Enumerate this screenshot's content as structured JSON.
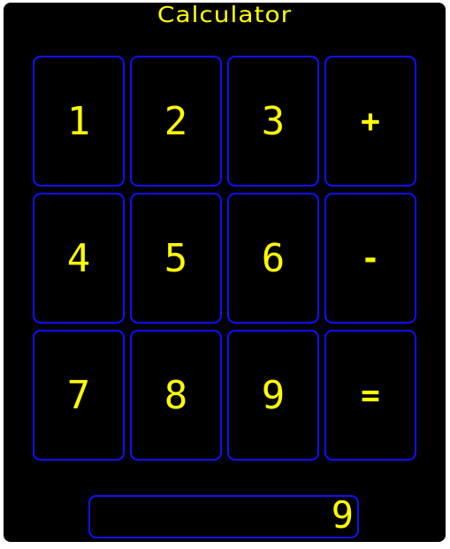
{
  "app": {
    "title": "Calculator"
  },
  "keypad": {
    "rows": [
      [
        {
          "label": "1",
          "name": "key-1-button"
        },
        {
          "label": "2",
          "name": "key-2-button"
        },
        {
          "label": "3",
          "name": "key-3-button"
        },
        {
          "label": "+",
          "name": "plus-button"
        }
      ],
      [
        {
          "label": "4",
          "name": "key-4-button"
        },
        {
          "label": "5",
          "name": "key-5-button"
        },
        {
          "label": "6",
          "name": "key-6-button"
        },
        {
          "label": "-",
          "name": "minus-button"
        }
      ],
      [
        {
          "label": "7",
          "name": "key-7-button"
        },
        {
          "label": "8",
          "name": "key-8-button"
        },
        {
          "label": "9",
          "name": "key-9-button"
        },
        {
          "label": "=",
          "name": "equals-button"
        }
      ]
    ]
  },
  "display": {
    "value": "9"
  },
  "colors": {
    "background": "#000000",
    "text": "#ffff00",
    "border": "#1010ff"
  }
}
